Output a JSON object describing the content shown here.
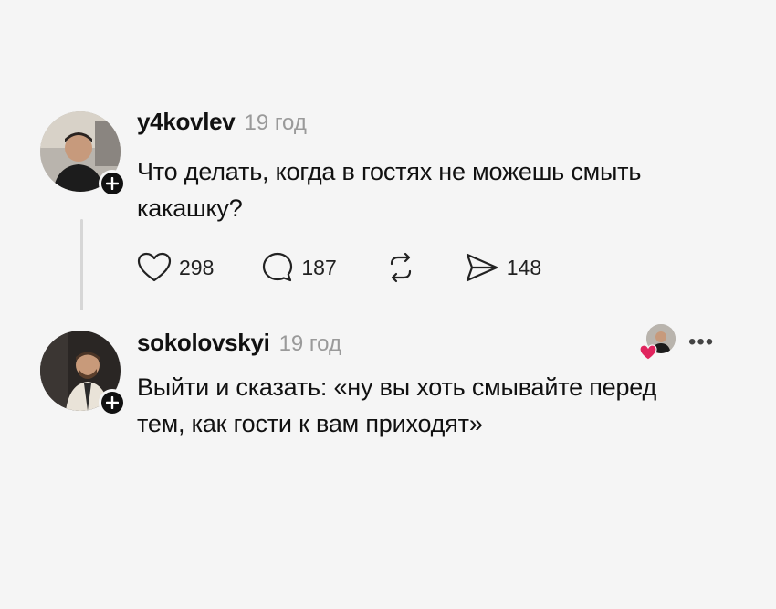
{
  "post": {
    "username": "y4kovlev",
    "time": "19 год",
    "text_line1": "Что делать, когда в гостях не можешь смыть",
    "text_line2": "какашку?",
    "likes": "298",
    "comments": "187",
    "shares": "148",
    "icons": {
      "like": "heart-icon",
      "comment": "comment-bubble-icon",
      "repost": "repost-icon",
      "share": "send-icon"
    }
  },
  "reply": {
    "username": "sokolovskyi",
    "time": "19 год",
    "text_line1": "Выйти и сказать: «ну вы хоть смывайте перед",
    "text_line2": "тем, как гости к вам приходят»",
    "more": "•••",
    "icons": {
      "liked_by": "liked-by-author-heart-icon",
      "more": "more-options-icon"
    }
  },
  "colors": {
    "background": "#f5f5f5",
    "text": "#111111",
    "muted": "#9a9a9a",
    "heart": "#e0245e"
  }
}
